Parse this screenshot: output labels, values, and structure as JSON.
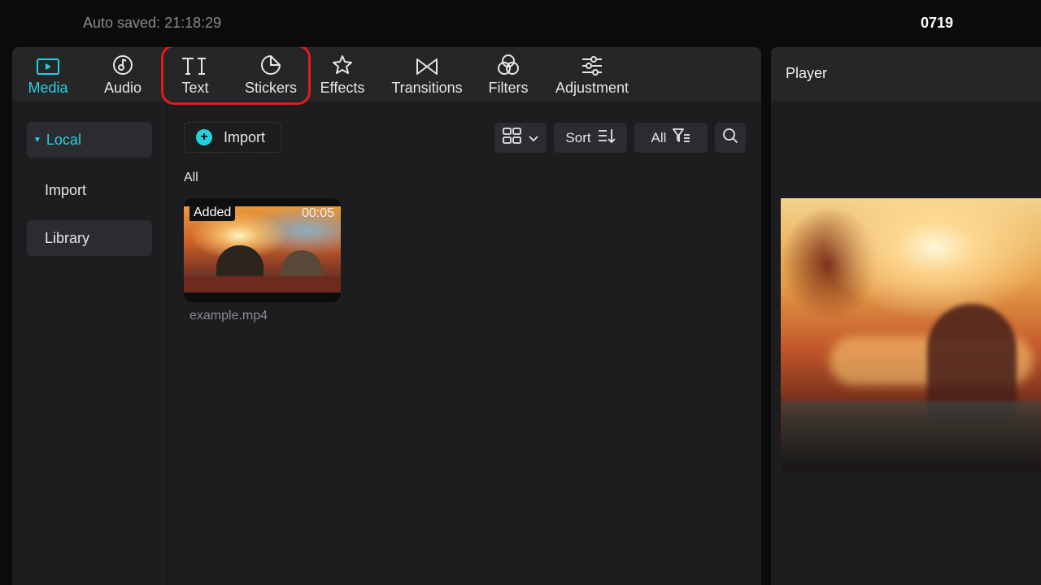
{
  "topbar": {
    "autosave": "Auto saved: 21:18:29",
    "project_name": "0719"
  },
  "toolbar": {
    "tabs": [
      {
        "label": "Media",
        "icon": "media-icon",
        "active": true
      },
      {
        "label": "Audio",
        "icon": "audio-icon",
        "active": false
      },
      {
        "label": "Text",
        "icon": "text-icon",
        "active": false
      },
      {
        "label": "Stickers",
        "icon": "stickers-icon",
        "active": false
      },
      {
        "label": "Effects",
        "icon": "effects-icon",
        "active": false
      },
      {
        "label": "Transitions",
        "icon": "transitions-icon",
        "active": false
      },
      {
        "label": "Filters",
        "icon": "filters-icon",
        "active": false
      },
      {
        "label": "Adjustment",
        "icon": "adjustment-icon",
        "active": false
      }
    ]
  },
  "sidebar": {
    "items": [
      {
        "label": "Local",
        "selected": true
      },
      {
        "label": "Import",
        "selected": false
      },
      {
        "label": "Library",
        "selected": false
      }
    ]
  },
  "content": {
    "import_label": "Import",
    "sort_label": "Sort",
    "filter_label": "All",
    "section_label": "All",
    "media": [
      {
        "badge": "Added",
        "duration": "00:05",
        "filename": "example.mp4"
      }
    ]
  },
  "player": {
    "title": "Player"
  },
  "colors": {
    "accent": "#22d3df",
    "highlight": "#e31b1b",
    "panel_bg": "#1d1d20",
    "toolbar_bg": "#262629"
  }
}
